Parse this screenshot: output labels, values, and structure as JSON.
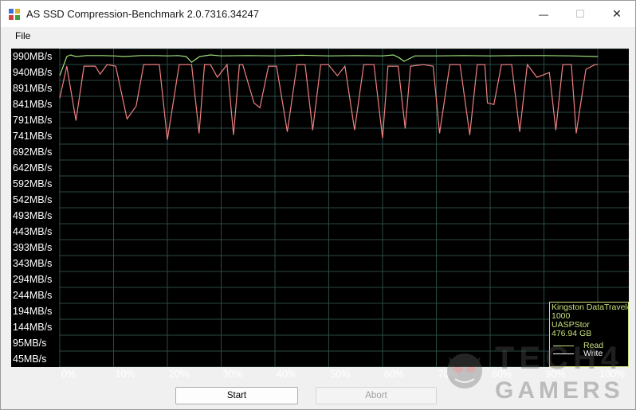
{
  "window": {
    "title": "AS SSD Compression-Benchmark 2.0.7316.34247",
    "minimize_glyph": "—",
    "maximize_glyph": "☐",
    "close_glyph": "✕",
    "icon": "benchmark-app-icon"
  },
  "menu": {
    "file_label": "File"
  },
  "buttons": {
    "start_label": "Start",
    "abort_label": "Abort"
  },
  "legend": {
    "device_line1": "Kingston DataTraveler",
    "device_line2": "1000",
    "device_line3": "UASPStor",
    "device_line4": "476.94 GB",
    "read_label": "Read",
    "write_label": "Write",
    "read_color": "#c7e07a",
    "write_color": "#ffffff"
  },
  "watermark": {
    "line1": "TECH4",
    "line2": "GAMERS"
  },
  "chart_data": {
    "type": "line",
    "background": "#000000",
    "grid": true,
    "grid_color": "#2a4a44",
    "legend_position": "bottom-right",
    "y_tick_labels": [
      "990MB/s",
      "940MB/s",
      "891MB/s",
      "841MB/s",
      "791MB/s",
      "741MB/s",
      "692MB/s",
      "642MB/s",
      "592MB/s",
      "542MB/s",
      "493MB/s",
      "443MB/s",
      "393MB/s",
      "343MB/s",
      "294MB/s",
      "244MB/s",
      "194MB/s",
      "144MB/s",
      "95MB/s",
      "45MB/s"
    ],
    "y_tick_values": [
      990,
      940,
      891,
      841,
      791,
      741,
      692,
      642,
      592,
      542,
      493,
      443,
      393,
      343,
      294,
      244,
      194,
      144,
      95,
      45
    ],
    "x_tick_labels": [
      "0%",
      "10%",
      "20%",
      "30%",
      "40%",
      "50%",
      "60%",
      "70%",
      "80%",
      "90%",
      "100%"
    ],
    "x_tick_values": [
      0,
      10,
      20,
      30,
      40,
      50,
      60,
      70,
      80,
      90,
      100
    ],
    "xlim": [
      0,
      100
    ],
    "ylim": [
      20,
      1015
    ],
    "series": [
      {
        "name": "Read",
        "color": "#9ee07a",
        "x": [
          0,
          1.3,
          2,
          3,
          5,
          8,
          10,
          12,
          15,
          18,
          20,
          22,
          23.5,
          24.5,
          26,
          28,
          30,
          35,
          40,
          45,
          50,
          55,
          60,
          62,
          63,
          64,
          66,
          70,
          75,
          80,
          85,
          90,
          95,
          100
        ],
        "y": [
          930,
          990,
          995,
          990,
          993,
          993,
          992,
          990,
          993,
          993,
          992,
          993,
          990,
          972,
          990,
          995,
          992,
          993,
          992,
          994,
          992,
          993,
          992,
          995,
          987,
          975,
          992,
          992,
          993,
          992,
          993,
          993,
          992,
          990
        ]
      },
      {
        "name": "Write",
        "color": "#f08080",
        "x": [
          0,
          1.3,
          3,
          4.5,
          6.6,
          7.5,
          8.8,
          10.4,
          12.5,
          14.2,
          15.6,
          18.5,
          20,
          22.2,
          24.5,
          25.9,
          26.9,
          28,
          29.3,
          31.1,
          32.3,
          33.4,
          34,
          36.1,
          37.2,
          38.8,
          40.3,
          42.3,
          44.1,
          45.6,
          47,
          48.5,
          49.9,
          51.6,
          53,
          54.8,
          56.5,
          58.4,
          60,
          61,
          62.9,
          64.2,
          65.2,
          67.6,
          69.4,
          70.6,
          72.5,
          74.4,
          76.2,
          77.6,
          79,
          79.5,
          80.7,
          82.1,
          84,
          85.5,
          86.9,
          88.7,
          91,
          92.2,
          93.5,
          95.1,
          96,
          97.8,
          99.5,
          100
        ],
        "y": [
          860,
          960,
          790,
          960,
          960,
          935,
          965,
          960,
          795,
          835,
          965,
          965,
          730,
          965,
          965,
          750,
          965,
          965,
          925,
          965,
          745,
          965,
          965,
          845,
          830,
          960,
          960,
          755,
          965,
          965,
          760,
          965,
          965,
          930,
          960,
          760,
          965,
          965,
          735,
          960,
          960,
          765,
          960,
          965,
          960,
          750,
          965,
          965,
          745,
          965,
          965,
          845,
          840,
          965,
          965,
          755,
          965,
          925,
          940,
          760,
          965,
          965,
          750,
          950,
          965,
          965
        ]
      }
    ]
  }
}
